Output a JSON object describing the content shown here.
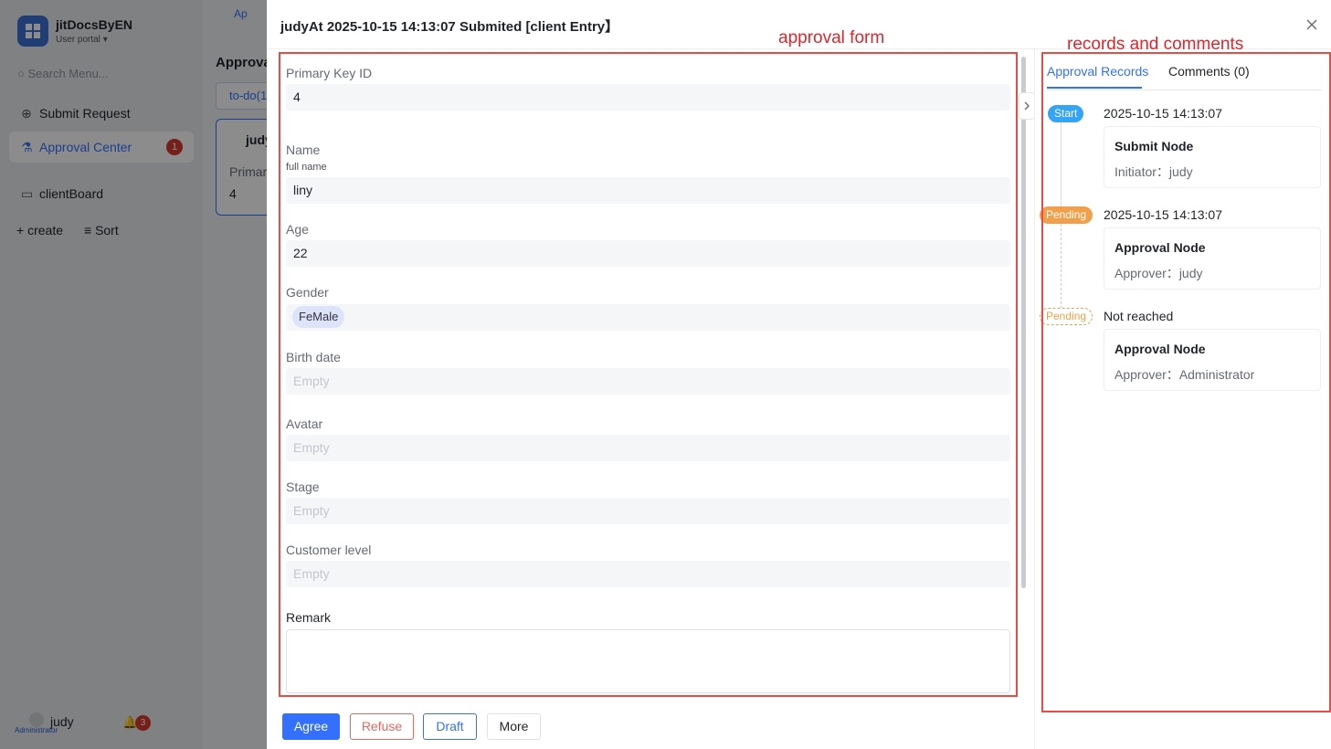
{
  "app": {
    "name": "jitDocsByEN",
    "portal": "User portal",
    "search_placeholder": "Search Menu...",
    "nav": [
      {
        "label": "Submit Request"
      },
      {
        "label": "Approval Center",
        "badge": "1"
      },
      {
        "label": "clientBoard"
      }
    ],
    "create_label": "create",
    "sort_label": "Sort",
    "user": {
      "name": "judy",
      "role": "Administrator",
      "notifications": "3"
    },
    "bg": {
      "tab_label": "Ap",
      "heading": "Approva",
      "todo": "to-do(1",
      "card_title": "judy",
      "card_label": "Primar",
      "card_value": "4"
    }
  },
  "drawer": {
    "title": "judyAt  2025-10-15 14:13:07 Submited [client Entry】",
    "fields": {
      "primary_key": {
        "label": "Primary Key ID",
        "value": "4"
      },
      "name": {
        "label": "Name",
        "sublabel": "full name",
        "value": "liny"
      },
      "age": {
        "label": "Age",
        "value": "22"
      },
      "gender": {
        "label": "Gender",
        "value": "FeMale"
      },
      "birth_date": {
        "label": "Birth date",
        "value": "Empty"
      },
      "avatar": {
        "label": "Avatar",
        "value": "Empty"
      },
      "stage": {
        "label": "Stage",
        "value": "Empty"
      },
      "customer_level": {
        "label": "Customer level",
        "value": "Empty"
      },
      "remark": {
        "label": "Remark",
        "value": ""
      }
    },
    "buttons": {
      "agree": "Agree",
      "refuse": "Refuse",
      "draft": "Draft",
      "more": "More"
    },
    "annotations": {
      "form": "approval form",
      "records": "records and comments"
    },
    "tabs": {
      "records": "Approval Records",
      "comments": "Comments (0)"
    },
    "timeline": [
      {
        "tag": "Start",
        "time": "2025-10-15 14:13:07",
        "node": "Submit Node",
        "person_label": "Initiator：",
        "person": "judy"
      },
      {
        "tag": "Pending",
        "time": "2025-10-15 14:13:07",
        "node": "Approval Node",
        "person_label": "Approver：",
        "person": "judy"
      },
      {
        "tag": "Pending",
        "time": "Not reached",
        "node": "Approval Node",
        "person_label": "Approver：",
        "person": "Administrator"
      }
    ],
    "colors": {
      "primary": "#3370ff",
      "danger": "#f0645e",
      "start_tag": "#35a4f5",
      "pending_tag": "#f0a04b",
      "annotation": "#e0262c"
    }
  }
}
